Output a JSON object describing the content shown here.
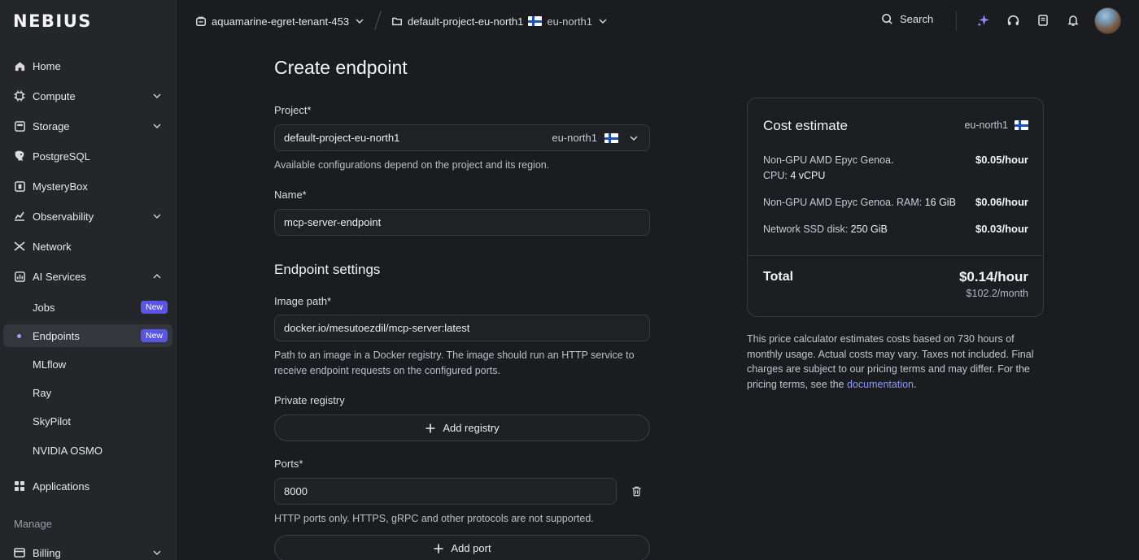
{
  "brand": {
    "logo_text": "NEBIUS"
  },
  "topbar": {
    "tenant": "aquamarine-egret-tenant-453",
    "project": "default-project-eu-north1",
    "region": "eu-north1",
    "search_label": "Search"
  },
  "sidebar": {
    "items": [
      {
        "label": "Home",
        "icon": "home-icon"
      },
      {
        "label": "Compute",
        "icon": "compute-icon",
        "expandable": true
      },
      {
        "label": "Storage",
        "icon": "storage-icon",
        "expandable": true
      },
      {
        "label": "PostgreSQL",
        "icon": "postgres-icon"
      },
      {
        "label": "MysteryBox",
        "icon": "mysterybox-icon"
      },
      {
        "label": "Observability",
        "icon": "observability-icon",
        "expandable": true
      },
      {
        "label": "Network",
        "icon": "network-icon"
      },
      {
        "label": "AI Services",
        "icon": "ai-services-icon",
        "expanded": true
      }
    ],
    "sub_items": [
      {
        "label": "Jobs",
        "badge": "New"
      },
      {
        "label": "Endpoints",
        "badge": "New",
        "active": true
      },
      {
        "label": "MLflow"
      },
      {
        "label": "Ray"
      },
      {
        "label": "SkyPilot"
      },
      {
        "label": "NVIDIA OSMO"
      }
    ],
    "applications_label": "Applications",
    "manage_label": "Manage",
    "billing_label": "Billing"
  },
  "form": {
    "title": "Create endpoint",
    "project_label": "Project*",
    "project_value": "default-project-eu-north1",
    "project_region": "eu-north1",
    "project_help": "Available configurations depend on the project and its region.",
    "name_label": "Name*",
    "name_value": "mcp-server-endpoint",
    "settings_title": "Endpoint settings",
    "image_label": "Image path*",
    "image_value": "docker.io/mesutoezdil/mcp-server:latest",
    "image_help": "Path to an image in a Docker registry. The image should run an HTTP service to receive endpoint requests on the configured ports.",
    "registry_label": "Private registry",
    "add_registry": "Add registry",
    "ports_label": "Ports*",
    "port_value": "8000",
    "ports_help": "HTTP ports only. HTTPS, gRPC and other protocols are not supported.",
    "add_port": "Add port"
  },
  "cost": {
    "title": "Cost estimate",
    "region": "eu-north1",
    "rows": [
      {
        "text_a": "Non-GPU AMD Epyc Genoa.",
        "text_b": "CPU: ",
        "value": "4 vCPU",
        "price": "$0.05/hour"
      },
      {
        "text_a": "Non-GPU AMD Epyc Genoa. RAM: ",
        "value": "16 GiB",
        "price": "$0.06/hour"
      },
      {
        "text_a": "Network SSD disk: ",
        "value": "250 GiB",
        "price": "$0.03/hour"
      }
    ],
    "total_label": "Total",
    "total_hour": "$0.14/hour",
    "total_month": "$102.2/month",
    "note": "This price calculator estimates costs based on 730 hours of monthly usage. Actual costs may vary. Taxes not included. Final charges are subject to our pricing terms and may differ. For the pricing terms, see the ",
    "note_link": "documentation",
    "note_end": "."
  },
  "colors": {
    "accent": "#5a55e6",
    "link": "#8e98ff",
    "background": "#1b1c20",
    "sidebar": "#252629"
  }
}
